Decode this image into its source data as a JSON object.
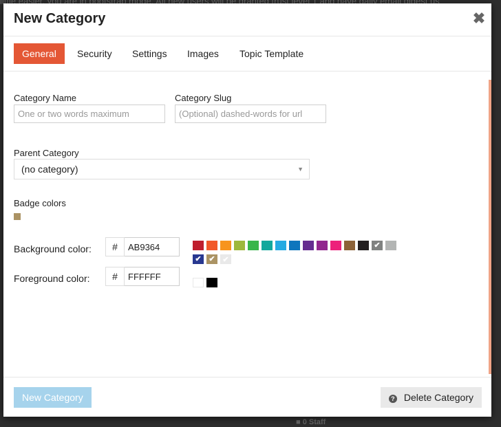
{
  "background": {
    "top_text": "little easier, you are in bootstrap mode. All new users will be granted trust level 1 and have daily email digest us",
    "bottom_text": "■ 0 Staff"
  },
  "modal": {
    "title": "New Category",
    "close_glyph": "✖"
  },
  "tabs": [
    {
      "label": "General",
      "active": true
    },
    {
      "label": "Security",
      "active": false
    },
    {
      "label": "Settings",
      "active": false
    },
    {
      "label": "Images",
      "active": false
    },
    {
      "label": "Topic Template",
      "active": false
    }
  ],
  "form": {
    "name_label": "Category Name",
    "name_placeholder": "One or two words maximum",
    "name_value": "",
    "slug_label": "Category Slug",
    "slug_placeholder": "(Optional) dashed-words for url",
    "slug_value": "",
    "parent_label": "Parent Category",
    "parent_selected": "(no category)",
    "parent_arrow": "▼",
    "badge_label": "Badge colors",
    "badge_color": "#AB9364",
    "bg_label": "Background color:",
    "bg_hash": "#",
    "bg_value": "AB9364",
    "fg_label": "Foreground color:",
    "fg_hash": "#",
    "fg_value": "FFFFFF"
  },
  "bg_swatches": [
    {
      "color": "#BF1E2E",
      "check": ""
    },
    {
      "color": "#F1592A",
      "check": ""
    },
    {
      "color": "#F7941D",
      "check": ""
    },
    {
      "color": "#9EB83B",
      "check": ""
    },
    {
      "color": "#3AB54A",
      "check": ""
    },
    {
      "color": "#12A89D",
      "check": ""
    },
    {
      "color": "#25AAE2",
      "check": ""
    },
    {
      "color": "#0E76BD",
      "check": ""
    },
    {
      "color": "#652D90",
      "check": ""
    },
    {
      "color": "#92278F",
      "check": ""
    },
    {
      "color": "#ED207B",
      "check": ""
    },
    {
      "color": "#8C6238",
      "check": ""
    },
    {
      "color": "#231F20",
      "check": ""
    },
    {
      "color": "#808281",
      "check": "✔"
    },
    {
      "color": "#B3B5B4",
      "check": ""
    },
    {
      "color": "#283890",
      "check": "✔"
    },
    {
      "color": "#AB9364",
      "check": "✔"
    },
    {
      "color": "#E9E9E9",
      "check": "✔"
    }
  ],
  "fg_swatches": [
    {
      "color": "#FFFFFF",
      "check": ""
    },
    {
      "color": "#000000",
      "check": ""
    }
  ],
  "footer": {
    "create_label": "New Category",
    "delete_icon": "?",
    "delete_label": "Delete Category"
  }
}
